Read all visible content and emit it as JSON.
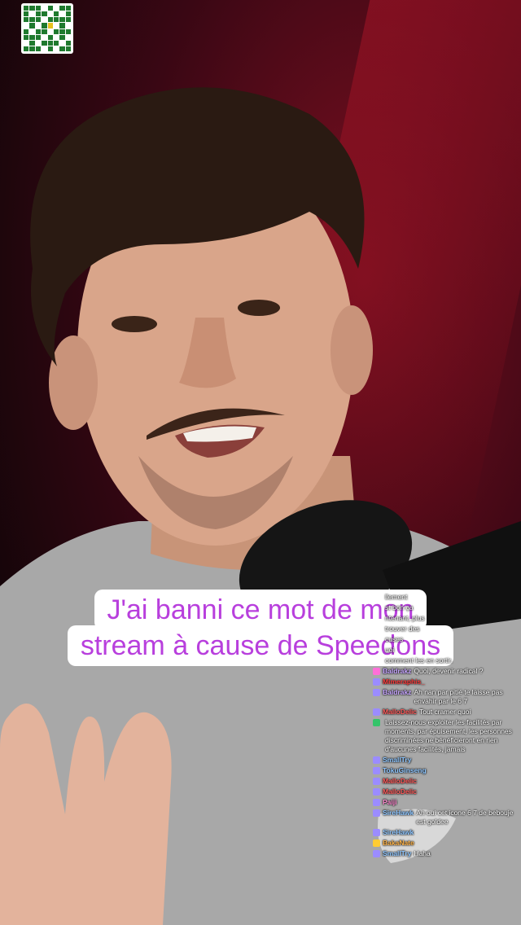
{
  "caption": {
    "line1": "J'ai banni ce mot de mon",
    "line2": "stream à cause de Speedons"
  },
  "colors": {
    "caption_text": "#b83fdd",
    "caption_bg": "#ffffff"
  },
  "chat": [
    {
      "user": "",
      "text": "llement",
      "user_color": "#8ec6ff",
      "icon": "none"
    },
    {
      "user": "",
      "text": "st bon ça",
      "user_color": "#8ec6ff",
      "icon": "none"
    },
    {
      "user": "",
      "text": "ntenant, plus",
      "user_color": "#8ec6ff",
      "icon": "none"
    },
    {
      "user": "",
      "text": "trouver des",
      "user_color": "#8ec6ff",
      "icon": "none"
    },
    {
      "user": "",
      "text": "cuses",
      "user_color": "#8ec6ff",
      "icon": "none"
    },
    {
      "user": "",
      "text": "uoi",
      "user_color": "#8ec6ff",
      "icon": "none"
    },
    {
      "user": "",
      "text": "comment les en sortir.",
      "user_color": "#8ec6ff",
      "icon": "none"
    },
    {
      "user": "Baldrakz",
      "text": "Quoi, devenir radical ?",
      "user_color": "#c7a6ff",
      "icon": "heart-icon"
    },
    {
      "user": "Mimeraphis_",
      "text": "",
      "user_color": "#ff3b3b",
      "icon": "sword-icon"
    },
    {
      "user": "Baldrakz",
      "text": "Ah nan par pitié te laisse pas envahir par le 6 7",
      "user_color": "#c7a6ff",
      "icon": "sword-icon"
    },
    {
      "user": "MalloDelic",
      "text": "Tout cramer quoi",
      "user_color": "#ff5a5a",
      "icon": "sword-icon"
    },
    {
      "user": "",
      "text": "Laissez-nous exploiter les facilités par moments, par épuisement, les personnes discriminées ne bénéficieront en rien d'aucunes facilités, jamais",
      "user_color": "#8ec6ff",
      "icon": "badge-icon"
    },
    {
      "user": "SmallTry",
      "text": "",
      "user_color": "#8ec6ff",
      "icon": "sword-icon"
    },
    {
      "user": "TokuGinseng",
      "text": "",
      "user_color": "#8ec6ff",
      "icon": "sword-icon"
    },
    {
      "user": "MalloDelic",
      "text": "",
      "user_color": "#ff5a5a",
      "icon": "sword-icon"
    },
    {
      "user": "MalloDelic",
      "text": "",
      "user_color": "#ff5a5a",
      "icon": "sword-icon"
    },
    {
      "user": "Paiji",
      "text": "",
      "user_color": "#ff8ad0",
      "icon": "sword-icon"
    },
    {
      "user": "SireHawk",
      "text": "Ah oui cet icone 6 7 de bebouje est goldee",
      "user_color": "#8ec6ff",
      "icon": "sword-icon"
    },
    {
      "user": "SireHawk",
      "text": "",
      "user_color": "#8ec6ff",
      "icon": "sword-icon"
    },
    {
      "user": "BakaNate",
      "text": "",
      "user_color": "#ffb347",
      "icon": "crown-icon"
    },
    {
      "user": "SmallTry",
      "text": "Haha",
      "user_color": "#8ec6ff",
      "icon": "sword-icon"
    }
  ]
}
